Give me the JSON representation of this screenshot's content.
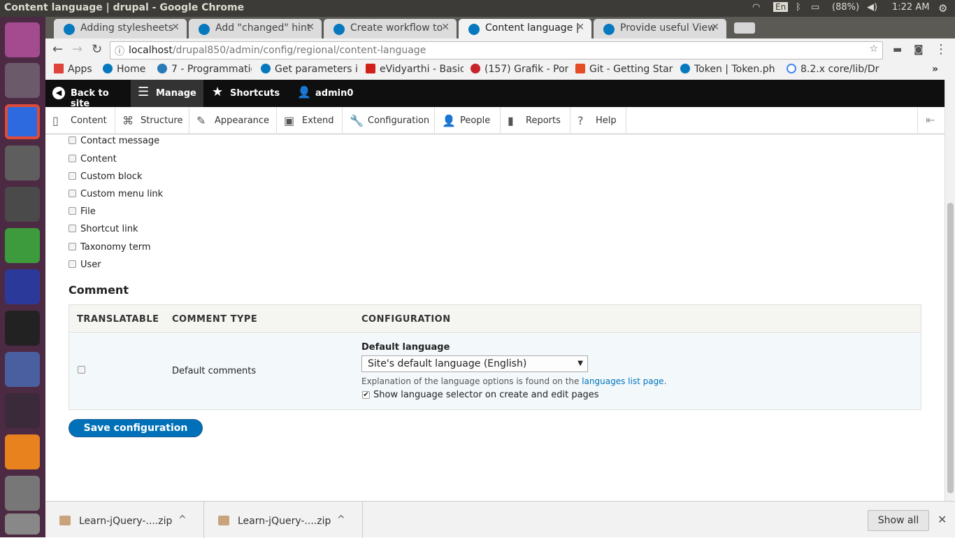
{
  "window": {
    "title": "Content language | drupal - Google Chrome",
    "lang": "En",
    "battery": "(88%)",
    "time": "1:22 AM"
  },
  "tabs": [
    {
      "label": "Adding stylesheets"
    },
    {
      "label": "Add \"changed\" hint"
    },
    {
      "label": "Create workflow to"
    },
    {
      "label": "Content language |"
    },
    {
      "label": "Provide useful View"
    }
  ],
  "url": {
    "host": "localhost",
    "path": "/drupal850/admin/config/regional/content-language"
  },
  "bookmarks": [
    "Apps",
    "Home",
    "7 - Programmatic",
    "Get parameters i",
    "eVidyarthi - Basic",
    "(157) Grafik - Por",
    "Git - Getting Star",
    "Token | Token.ph",
    "8.2.x core/lib/Dr"
  ],
  "toolbar": {
    "back": "Back to site",
    "manage": "Manage",
    "shortcuts": "Shortcuts",
    "user": "admin0"
  },
  "tray": [
    "Content",
    "Structure",
    "Appearance",
    "Extend",
    "Configuration",
    "People",
    "Reports",
    "Help"
  ],
  "entities": [
    "Contact message",
    "Content",
    "Custom block",
    "Custom menu link",
    "File",
    "Shortcut link",
    "Taxonomy term",
    "User"
  ],
  "comment": {
    "heading": "Comment",
    "columns": [
      "TRANSLATABLE",
      "COMMENT TYPE",
      "CONFIGURATION"
    ],
    "row": {
      "type": "Default comments",
      "default_language_label": "Default language",
      "select_value": "Site's default language (English)",
      "explanation": "Explanation of the language options is found on the ",
      "link": "languages list page",
      "period": ".",
      "show_selector": "Show language selector on create and edit pages"
    }
  },
  "save_label": "Save configuration",
  "downloads": [
    "Learn-jQuery-....zip",
    "Learn-jQuery-....zip"
  ],
  "show_all": "Show all"
}
